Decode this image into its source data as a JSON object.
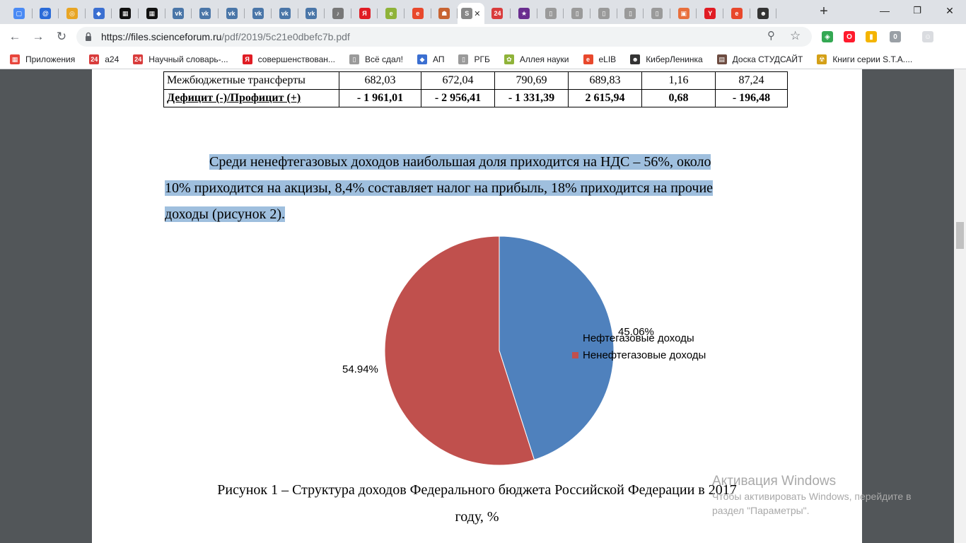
{
  "browser": {
    "tabs": [
      {
        "icon": "chat-icon",
        "color": "#4a8af4",
        "glyph": "▢"
      },
      {
        "icon": "mail-at-icon",
        "color": "#2a6bd8",
        "glyph": "@"
      },
      {
        "icon": "glasses-icon",
        "color": "#e8a524",
        "glyph": "◎"
      },
      {
        "icon": "shield-icon",
        "color": "#3b6fd1",
        "glyph": "◆"
      },
      {
        "icon": "clapper-icon",
        "color": "#111111",
        "glyph": "▦"
      },
      {
        "icon": "clapper-icon",
        "color": "#111111",
        "glyph": "▦"
      },
      {
        "icon": "vk-icon",
        "color": "#4a76a8",
        "glyph": "vk"
      },
      {
        "icon": "vk-icon",
        "color": "#4a76a8",
        "glyph": "vk"
      },
      {
        "icon": "vk-icon",
        "color": "#4a76a8",
        "glyph": "vk"
      },
      {
        "icon": "vk-icon",
        "color": "#4a76a8",
        "glyph": "vk"
      },
      {
        "icon": "vk-icon",
        "color": "#4a76a8",
        "glyph": "vk"
      },
      {
        "icon": "vk-icon",
        "color": "#4a76a8",
        "glyph": "vk"
      },
      {
        "icon": "audio-icon",
        "color": "#777777",
        "glyph": "♪"
      },
      {
        "icon": "yandex-icon",
        "color": "#e01c24",
        "glyph": "Я"
      },
      {
        "icon": "elib-icon",
        "color": "#8fb339",
        "glyph": "e"
      },
      {
        "icon": "elib-red-icon",
        "color": "#e8482c",
        "glyph": "e"
      },
      {
        "icon": "crest-icon",
        "color": "#c86432",
        "glyph": "☗"
      },
      {
        "icon": "file-icon",
        "color": "#888888",
        "glyph": "S",
        "active": true
      },
      {
        "icon": "a24-icon",
        "color": "#d93c3c",
        "glyph": "24"
      },
      {
        "icon": "cosmos-icon",
        "color": "#6a2e8f",
        "glyph": "★"
      },
      {
        "icon": "document-icon",
        "color": "#9a9a9a",
        "glyph": "▯"
      },
      {
        "icon": "document-icon",
        "color": "#9a9a9a",
        "glyph": "▯"
      },
      {
        "icon": "document-icon",
        "color": "#9a9a9a",
        "glyph": "▯"
      },
      {
        "icon": "document-icon",
        "color": "#9a9a9a",
        "glyph": "▯"
      },
      {
        "icon": "document-icon",
        "color": "#9a9a9a",
        "glyph": "▯"
      },
      {
        "icon": "slides-icon",
        "color": "#e86f3c",
        "glyph": "▣"
      },
      {
        "icon": "yandex-y-icon",
        "color": "#e01c24",
        "glyph": "Y"
      },
      {
        "icon": "elib-red-icon",
        "color": "#e8482c",
        "glyph": "e"
      },
      {
        "icon": "cyberleninka-icon",
        "color": "#333333",
        "glyph": "☻"
      }
    ],
    "active_tab_close": "✕",
    "new_tab": "+",
    "url_host": "https://files.scienceforum.ru",
    "url_path": "/pdf/2019/5c21e0dbefc7b.pdf",
    "extensions": [
      {
        "icon": "extension-color-icon",
        "color": "#34a853",
        "glyph": "◈"
      },
      {
        "icon": "opera-icon",
        "color": "#ff1b2d",
        "glyph": "O"
      },
      {
        "icon": "bookmark-flag-icon",
        "color": "#f4b400",
        "glyph": "▮"
      },
      {
        "icon": "extension-counter-icon",
        "color": "#9aa0a6",
        "glyph": "0"
      },
      {
        "icon": "profile-icon",
        "color": "#dadce0",
        "glyph": "☺"
      }
    ],
    "bookmarks": [
      {
        "label": "Приложения",
        "icon": "apps-grid-icon",
        "color": "#e8453c",
        "glyph": "▦"
      },
      {
        "label": "a24",
        "icon": "a24-icon",
        "color": "#d93c3c",
        "glyph": "24"
      },
      {
        "label": "Научный словарь-...",
        "icon": "a24-icon",
        "color": "#d93c3c",
        "glyph": "24"
      },
      {
        "label": "совершенствован...",
        "icon": "yandex-icon",
        "color": "#e01c24",
        "glyph": "Я"
      },
      {
        "label": "Всё сдал!",
        "icon": "page-icon",
        "color": "#9a9a9a",
        "glyph": "▯"
      },
      {
        "label": "АП",
        "icon": "shield-icon",
        "color": "#3b6fd1",
        "glyph": "◆"
      },
      {
        "label": "РГБ",
        "icon": "page-icon",
        "color": "#9a9a9a",
        "glyph": "▯"
      },
      {
        "label": "Аллея науки",
        "icon": "leaf-icon",
        "color": "#8fb339",
        "glyph": "✿"
      },
      {
        "label": "eLIB",
        "icon": "elib-red-icon",
        "color": "#e8482c",
        "glyph": "e"
      },
      {
        "label": "КиберЛенинка",
        "icon": "cyberleninka-icon",
        "color": "#333333",
        "glyph": "☻"
      },
      {
        "label": "Доска СТУДСАЙТ",
        "icon": "board-icon",
        "color": "#6d4c41",
        "glyph": "▤"
      },
      {
        "label": "Книги серии S.T.A....",
        "icon": "radiation-icon",
        "color": "#d4a017",
        "glyph": "☢"
      }
    ]
  },
  "document": {
    "table_rows": [
      {
        "label": "Межбюджетные трансферты",
        "values": [
          "682,03",
          "672,04",
          "790,69",
          "689,83",
          "1,16",
          "87,24"
        ],
        "bold": false
      },
      {
        "label": "Дефицит (-)/Профицит (+)",
        "values": [
          "-  1 961,01",
          "-  2 956,41",
          "-   1 331,39",
          "2 615,94",
          "0,68",
          "-  196,48"
        ],
        "bold": true
      }
    ],
    "paragraph_lines": [
      "Среди ненефтегазовых доходов наибольшая доля приходится на НДС – 56%, около",
      "10% приходится на акцизы, 8,4% составляет налог на прибыль, 18% приходится на прочие",
      "доходы (рисунок 2)."
    ],
    "caption_lines": [
      "Рисунок 1 – Структура доходов Федерального бюджета Российской Федерации в 2017",
      "году, %"
    ]
  },
  "chart_data": {
    "type": "pie",
    "title": "",
    "series": [
      {
        "name": "Нефтегазовые доходы",
        "value": 45.06,
        "label": "45.06%",
        "color": "#4f81bd"
      },
      {
        "name": "Ненефтегазовые доходы",
        "value": 54.94,
        "label": "54.94%",
        "color": "#c0504d"
      }
    ],
    "legend_position": "right"
  },
  "watermark": {
    "title": "Активация Windows",
    "subtitle_lines": [
      "Чтобы активировать Windows, перейдите в",
      "раздел \"Параметры\"."
    ]
  }
}
